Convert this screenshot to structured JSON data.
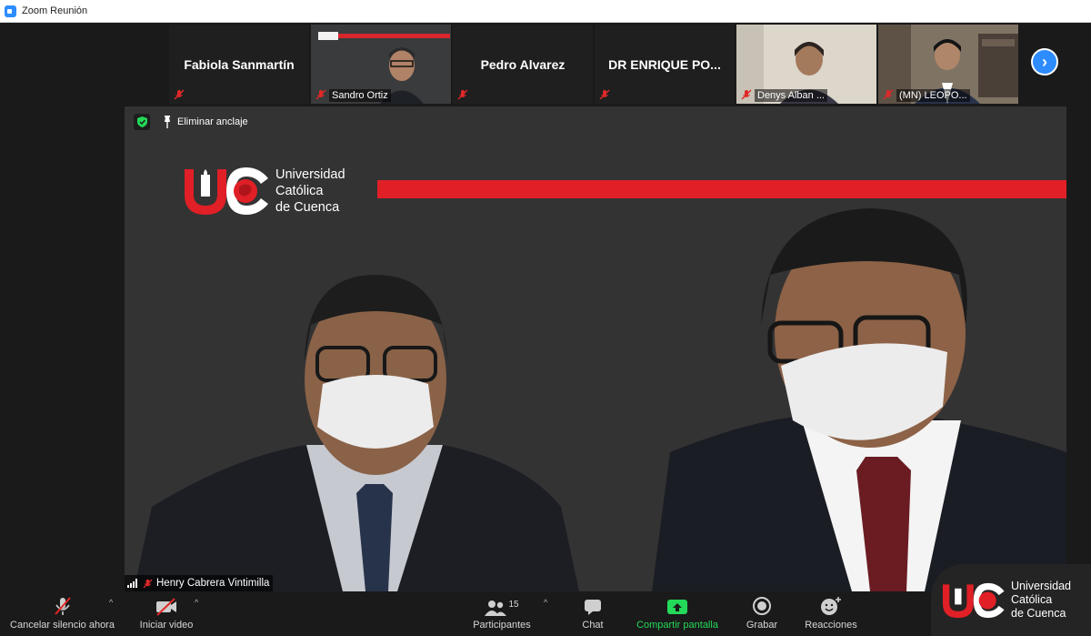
{
  "window": {
    "title": "Zoom Reunión"
  },
  "thumbnails": [
    {
      "name": "Fabiola Sanmartín",
      "has_video": false
    },
    {
      "name": "Sandro Ortiz",
      "has_video": true
    },
    {
      "name": "Pedro Alvarez",
      "has_video": false
    },
    {
      "name": "DR ENRIQUE PO...",
      "has_video": false
    },
    {
      "name": "Denys Alban ...",
      "has_video": true
    },
    {
      "name": "(MN) LEOPO...",
      "has_video": true
    }
  ],
  "main_video": {
    "unpin_label": "Eliminar anclaje",
    "speaker_name": "Henry Cabrera Vintimilla",
    "logo_text": [
      "Universidad",
      "Católica",
      "de Cuenca"
    ]
  },
  "toolbar": {
    "mute_label": "Cancelar silencio ahora",
    "video_label": "Iniciar video",
    "participants_label": "Participantes",
    "participants_count": "15",
    "chat_label": "Chat",
    "share_label": "Compartir pantalla",
    "record_label": "Grabar",
    "reactions_label": "Reacciones"
  },
  "corner_logo_text": [
    "Universidad",
    "Católica",
    "de Cuenca"
  ],
  "colors": {
    "brand_red": "#e01f26",
    "zoom_blue": "#2d8cff",
    "share_green": "#23d959"
  }
}
